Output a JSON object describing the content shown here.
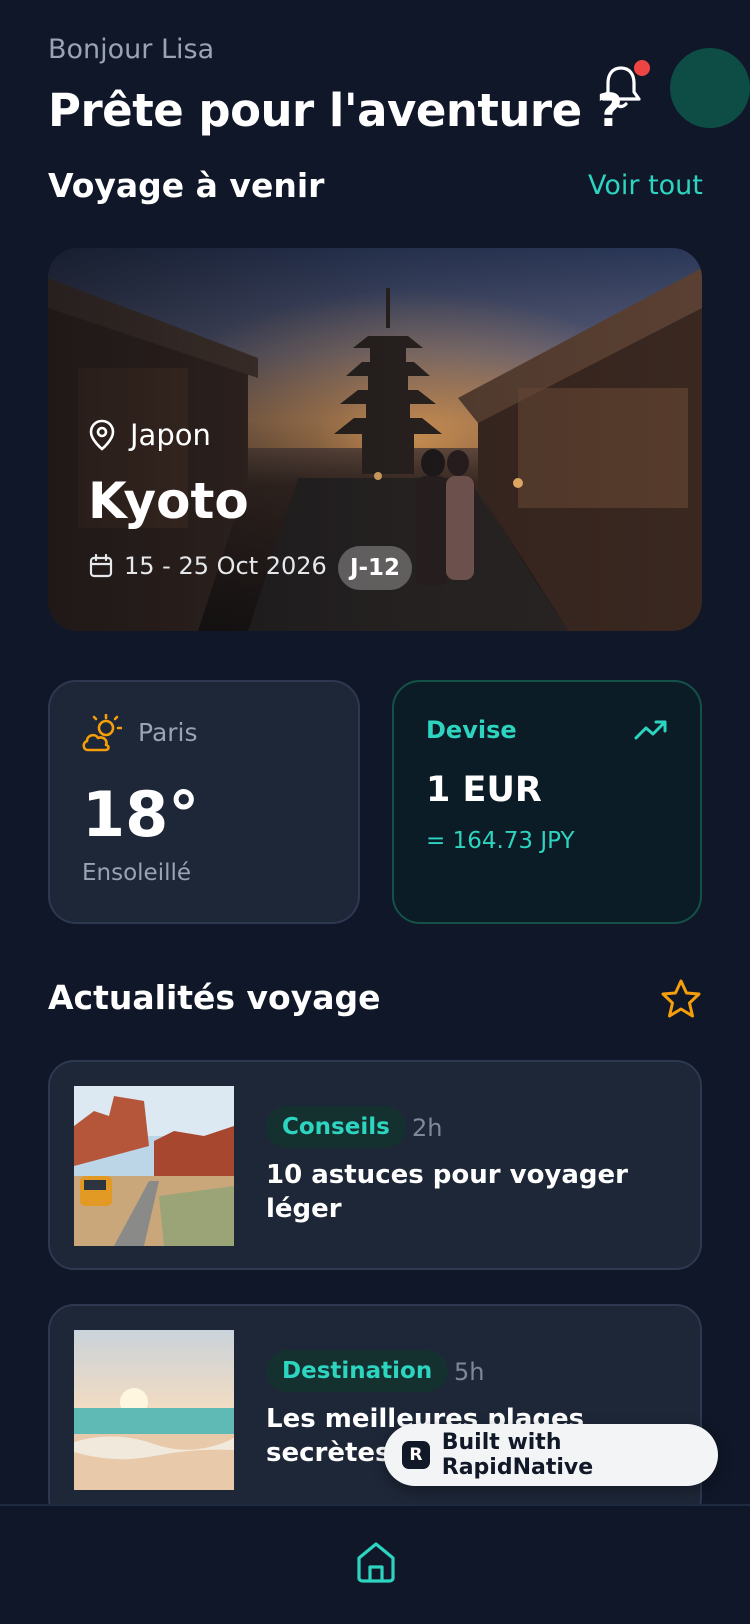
{
  "header": {
    "greeting": "Bonjour Lisa",
    "headline": "Prête pour l'aventure ?"
  },
  "upcoming": {
    "section_title": "Voyage à venir",
    "see_all": "Voir tout",
    "trip": {
      "country": "Japon",
      "city": "Kyoto",
      "dates": "15 - 25 Oct 2026",
      "countdown": "J-12"
    }
  },
  "weather": {
    "city": "Paris",
    "temperature": "18°",
    "condition": "Ensoleillé"
  },
  "currency": {
    "title": "Devise",
    "value": "1 EUR",
    "rate": "= 164.73 JPY"
  },
  "news": {
    "section_title": "Actualités voyage",
    "items": [
      {
        "category": "Conseils",
        "time": "2h",
        "title": "10 astuces pour voyager léger"
      },
      {
        "category": "Destination",
        "time": "5h",
        "title": "Les meilleures plages secrètes"
      }
    ]
  },
  "badge": {
    "label": "Built with RapidNative"
  },
  "colors": {
    "accent": "#2dd4bf",
    "background": "#0f1728",
    "card": "#1e2738",
    "notification": "#ef4444",
    "sun": "#f59e0b"
  },
  "icons": [
    "bell-icon",
    "map-pin-icon",
    "calendar-icon",
    "partly-sunny-icon",
    "trending-up-icon",
    "star-icon",
    "home-icon"
  ]
}
